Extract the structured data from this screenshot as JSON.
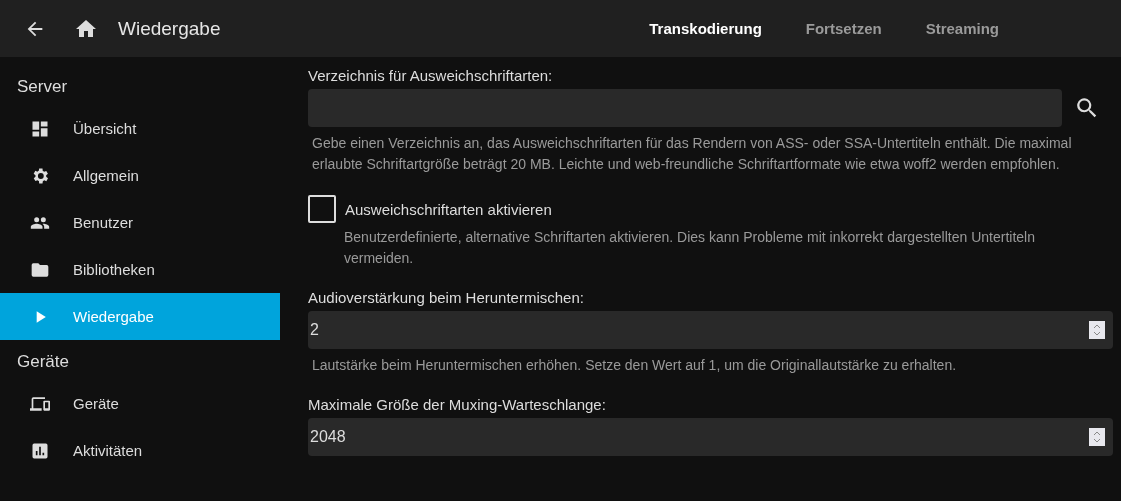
{
  "header": {
    "title": "Wiedergabe",
    "tabs": [
      {
        "label": "Transkodierung",
        "selected": true
      },
      {
        "label": "Fortsetzen",
        "selected": false
      },
      {
        "label": "Streaming",
        "selected": false
      }
    ]
  },
  "sidebar": {
    "sections": [
      {
        "title": "Server",
        "items": [
          {
            "label": "Übersicht",
            "kind": "dashboard",
            "selected": false
          },
          {
            "label": "Allgemein",
            "kind": "gear",
            "selected": false
          },
          {
            "label": "Benutzer",
            "kind": "people",
            "selected": false
          },
          {
            "label": "Bibliotheken",
            "kind": "folder",
            "selected": false
          },
          {
            "label": "Wiedergabe",
            "kind": "play",
            "selected": true
          }
        ]
      },
      {
        "title": "Geräte",
        "items": [
          {
            "label": "Geräte",
            "kind": "devices",
            "selected": false
          },
          {
            "label": "Aktivitäten",
            "kind": "chart",
            "selected": false
          }
        ]
      }
    ]
  },
  "settings": [
    {
      "kind": "path",
      "label": "Verzeichnis für Ausweichschriftarten:",
      "description": "Gebe einen Verzeichnis an, das Ausweichschriftarten für das Rendern von ASS- oder SSA-Untertiteln enthält. Die maximal erlaubte Schriftartgröße beträgt 20 MB. Leichte und web-freundliche Schriftartformate wie etwa woff2 werden empfohlen."
    },
    {
      "kind": "checkbox",
      "label": "Ausweichschriftarten aktivieren",
      "checked": false,
      "description": "Benutzerdefinierte, alternative Schriftarten aktivieren. Dies kann Probleme mit inkorrekt dargestellten Untertiteln vermeiden."
    },
    {
      "kind": "number",
      "label": "Audioverstärkung beim Heruntermischen:",
      "value": "2",
      "description": "Lautstärke beim Heruntermischen erhöhen. Setze den Wert auf 1, um die Originallautstärke zu erhalten."
    },
    {
      "kind": "number",
      "label": "Maximale Größe der Muxing-Warteschlange:",
      "value": "2048"
    }
  ]
}
